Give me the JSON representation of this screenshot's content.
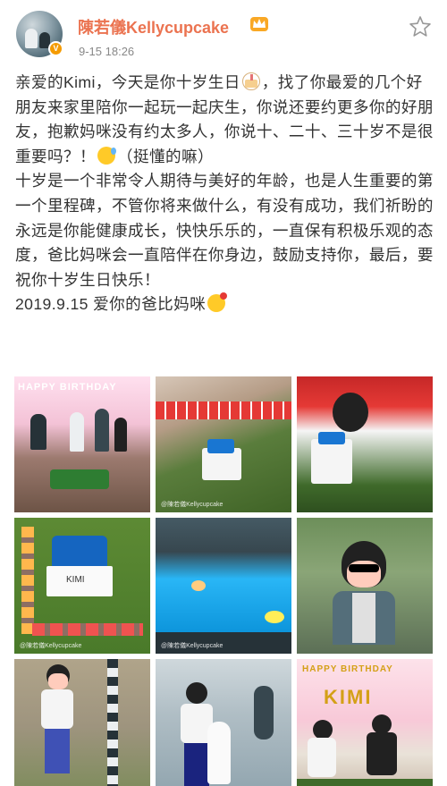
{
  "header": {
    "username": "陳若儀Kellycupcake",
    "timestamp": "9-15 18:26"
  },
  "post": {
    "lines": [
      "亲爱的Kimi，今天是你十岁生日",
      "，找了你最爱的几个好朋友来家里陪你一起玩一起庆生，你说还要约更多你的好朋友，抱歉妈咪没有约太多人，你说十、二十、三十岁不是很重要吗？！",
      "（挺懂的嘛）",
      "十岁是一个非常令人期待与美好的年龄，也是人生重要的第一个里程碑，不管你将来做什么，有没有成功，我们祈盼的永远是你能健康成长，快快乐乐的，一直保有积极乐观的态度，爸比妈咪会一直陪伴在你身边，鼓励支持你，最后，要祝你十岁生日快乐！",
      "2019.9.15 爱你的爸比妈咪"
    ]
  },
  "photos": [
    {
      "name": "party-kids-photo",
      "banner": "HAPPY BIRTHDAY"
    },
    {
      "name": "cake-table-photo"
    },
    {
      "name": "kid-with-cake-photo"
    },
    {
      "name": "cake-closeup-photo",
      "cake_label": "KIMI"
    },
    {
      "name": "pool-photo"
    },
    {
      "name": "kid-sunglasses-photo"
    },
    {
      "name": "kid-walking-photo"
    },
    {
      "name": "kid-with-alpaca-photo"
    },
    {
      "name": "kid-banner-photo",
      "banner": "HAPPY BIRTHDAY",
      "banner_name": "KIMI"
    }
  ],
  "icons": {
    "star": "star-outline-icon",
    "vip": "vip-badge-icon",
    "crown": "crown-badge-icon"
  },
  "colors": {
    "username": "#eb7350",
    "timestamp": "#888888",
    "text": "#333333"
  }
}
